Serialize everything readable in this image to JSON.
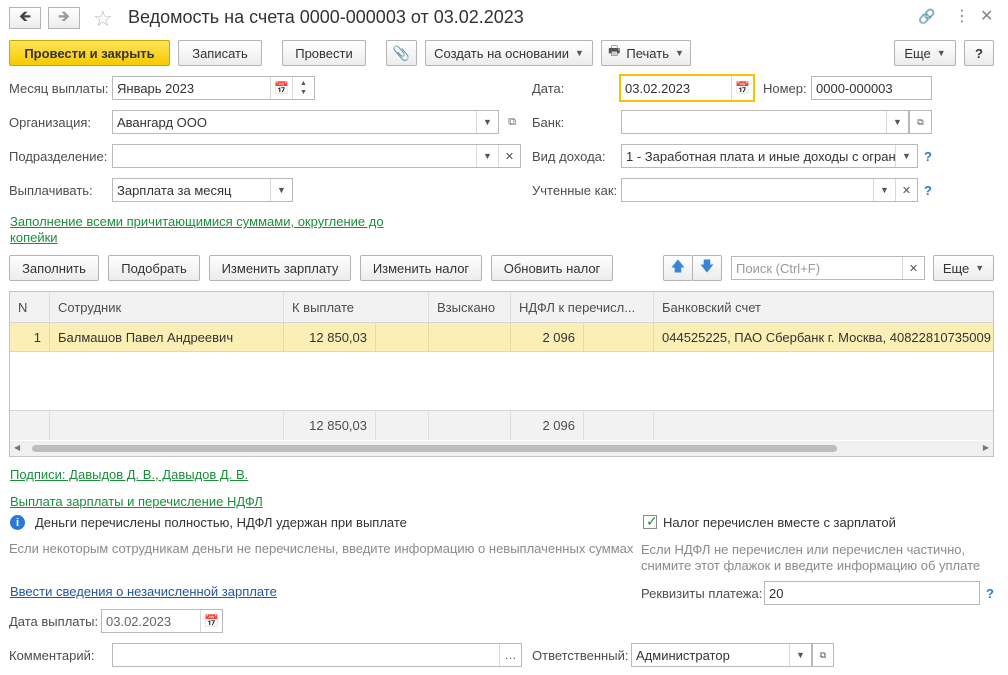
{
  "window": {
    "title": "Ведомость на счета 0000-000003 от 03.02.2023"
  },
  "toolbar": {
    "post_close": "Провести и закрыть",
    "save": "Записать",
    "post": "Провести",
    "create_based": "Создать на основании",
    "print": "Печать",
    "more": "Еще",
    "help": "?"
  },
  "form": {
    "month_label": "Месяц выплаты:",
    "month_value": "Январь 2023",
    "date_label": "Дата:",
    "date_value": "03.02.2023",
    "number_label": "Номер:",
    "number_value": "0000-000003",
    "org_label": "Организация:",
    "org_value": "Авангард ООО",
    "bank_label": "Банк:",
    "bank_value": "",
    "dept_label": "Подразделение:",
    "dept_value": "",
    "income_label": "Вид дохода:",
    "income_value": "1 - Заработная плата и иные доходы с огран",
    "pay_label": "Выплачивать:",
    "pay_value": "Зарплата за месяц",
    "counted_label": "Учтенные как:",
    "counted_value": "",
    "fill_link_line1": "Заполнение всеми причитающимися суммами, округление до",
    "fill_link_line2": "копейки"
  },
  "table_toolbar": {
    "fill": "Заполнить",
    "select": "Подобрать",
    "change_salary": "Изменить зарплату",
    "change_tax": "Изменить налог",
    "update_tax": "Обновить налог",
    "search_placeholder": "Поиск (Ctrl+F)",
    "more": "Еще"
  },
  "table": {
    "columns": [
      "N",
      "Сотрудник",
      "К выплате",
      "Взыскано",
      "НДФЛ к перечисл...",
      "Банковский счет"
    ],
    "rows": [
      {
        "n": "1",
        "employee": "Балмашов Павел Андреевич",
        "to_pay": "12 850,03",
        "collected": "",
        "ndfl": "2 096",
        "account": "044525225, ПАО Сбербанк г. Москва, 40822810735009"
      }
    ],
    "totals": {
      "to_pay": "12 850,03",
      "ndfl": "2 096"
    }
  },
  "bottom": {
    "signatures_link": "Подписи: Давыдов Д. В., Давыдов Д. В.",
    "payout_link": "Выплата зарплаты и перечисление НДФЛ",
    "info_text": "Деньги перечислены  полностью, НДФЛ удержан при выплате",
    "hint_left": "Если некоторым сотрудникам деньги не перечислены, введите информацию о невыплаченных суммах",
    "tax_checkbox_label": "Налог перечислен вместе с зарплатой",
    "tax_checked": true,
    "hint_right_line1": "Если НДФЛ не перечислен или перечислен частично,",
    "hint_right_line2": "снимите этот флажок и введите информацию об уплате",
    "unpaid_link": "Ввести сведения о незачисленной зарплате",
    "requisites_label": "Реквизиты платежа:",
    "requisites_value": "20",
    "pay_date_label": "Дата выплаты:",
    "pay_date_value": "03.02.2023",
    "comment_label": "Комментарий:",
    "comment_value": "",
    "responsible_label": "Ответственный:",
    "responsible_value": "Администратор"
  },
  "colors": {
    "accent_yellow": "#f7c900",
    "link_green": "#1a8f3a",
    "link_blue": "#2057a0",
    "row_highlight": "#fcefb5"
  }
}
